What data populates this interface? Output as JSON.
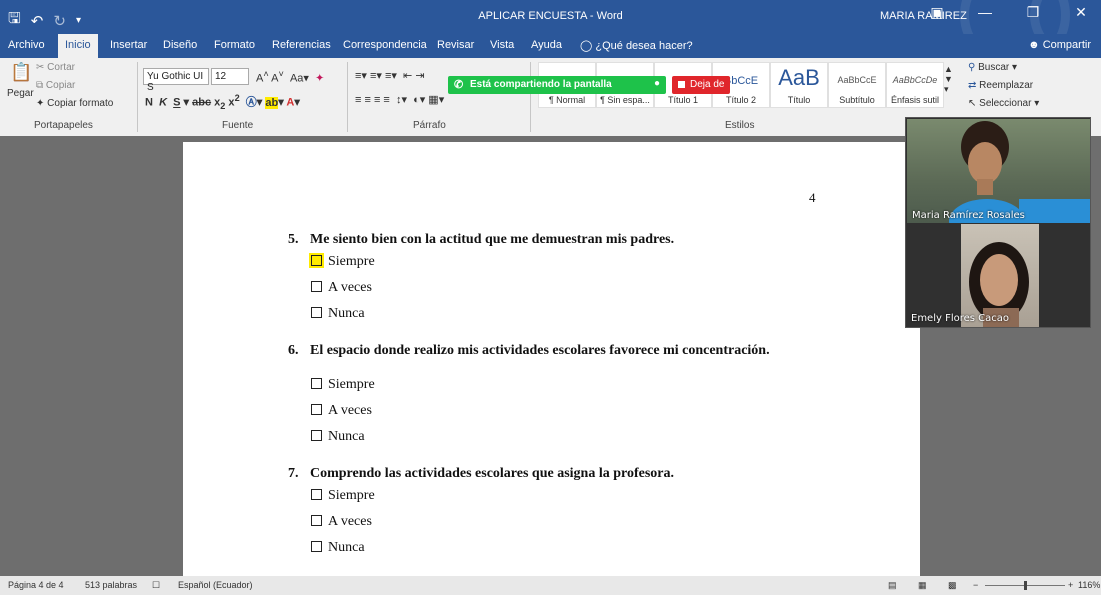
{
  "window": {
    "title": "APLICAR ENCUESTA - Word",
    "user": "MARIA RAMIREZ",
    "colors": {
      "brand": "#2b579a",
      "share_green": "#1ec24a",
      "stop_red": "#e0262b",
      "highlight": "#ffeb00"
    },
    "icons": [
      "save-icon",
      "undo-icon",
      "redo-icon",
      "customize-qat-icon",
      "ribbon-display-icon",
      "minimize-icon",
      "restore-icon",
      "close-icon"
    ]
  },
  "menu": {
    "tabs": [
      "Archivo",
      "Inicio",
      "Insertar",
      "Diseño",
      "Formato",
      "Referencias",
      "Correspondencia",
      "Revisar",
      "Vista",
      "Ayuda"
    ],
    "active_tab": "Inicio",
    "tell_me": "¿Qué desea hacer?",
    "share": "Compartir"
  },
  "ribbon": {
    "clipboard": {
      "paste": "Pegar",
      "cut": "Cortar",
      "copy": "Copiar",
      "format_painter": "Copiar formato",
      "label": "Portapapeles"
    },
    "font": {
      "family": "Yu Gothic UI S",
      "size": "12",
      "label": "Fuente"
    },
    "paragraph": {
      "label": "Párrafo"
    },
    "styles": {
      "label": "Estilos",
      "items": [
        {
          "name": "¶ Normal",
          "sample": ""
        },
        {
          "name": "¶ Sin espa...",
          "sample": ""
        },
        {
          "name": "Título 1",
          "sample": ""
        },
        {
          "name": "Título 2",
          "sample": "BbCcE"
        },
        {
          "name": "Título",
          "sample": "AaB"
        },
        {
          "name": "Subtítulo",
          "sample": "AaBbCcE"
        },
        {
          "name": "Énfasis sutil",
          "sample": "AaBbCcDe"
        }
      ]
    },
    "editing": {
      "find": "Buscar",
      "replace": "Reemplazar",
      "select": "Seleccionar"
    },
    "share_banner": "Está compartiendo la pantalla",
    "stop_sharing": "Deja de"
  },
  "document": {
    "page_number": "4",
    "questions": [
      {
        "number": "5.",
        "text": "Me siento bien con la actitud que me demuestran mis padres.",
        "options": [
          "Siempre",
          "A veces",
          "Nunca"
        ]
      },
      {
        "number": "6.",
        "text": "El espacio donde realizo mis actividades escolares favorece mi concentración.",
        "options": [
          "Siempre",
          "A veces",
          "Nunca"
        ]
      },
      {
        "number": "7.",
        "text": "Comprendo las actividades escolares que asigna la profesora.",
        "options": [
          "Siempre",
          "A veces",
          "Nunca"
        ]
      }
    ]
  },
  "video": {
    "participants": [
      "Maria Ramírez Rosales",
      "Emely Flores Cacao"
    ]
  },
  "status": {
    "page": "Página 4 de 4",
    "words": "513 palabras",
    "language": "Español (Ecuador)",
    "zoom": "116%"
  }
}
